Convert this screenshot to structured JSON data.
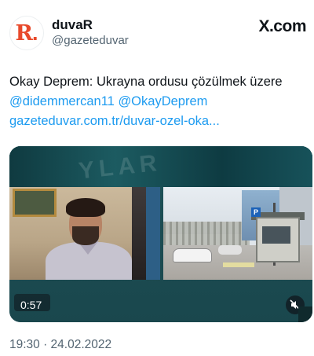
{
  "author": {
    "avatar_letter": "R",
    "avatar_dot": ".",
    "display_name": "duvaR",
    "handle": "@gazeteduvar"
  },
  "brand": "X.com",
  "tweet": {
    "text": "Okay Deprem: Ukrayna ordusu çözülmek üzere",
    "mention_1": "@didemmercan11",
    "mention_2": "@OkayDeprem",
    "link": "gazeteduvar.com.tr/duvar-ozel-oka..."
  },
  "media": {
    "watermark": "YLAR",
    "duration": "0:57",
    "sign_letter": "P",
    "mute_icon": "speaker-muted-icon"
  },
  "timestamp": "19:30 · 24.02.2022",
  "colors": {
    "link": "#1d9bf0",
    "brand_red": "#e8492b",
    "secondary_text": "#536471"
  }
}
